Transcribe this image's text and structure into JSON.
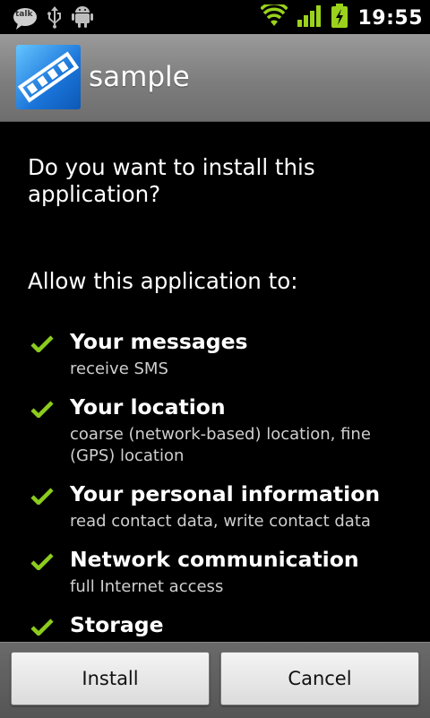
{
  "status_bar": {
    "talk_label": "talk",
    "time": "19:55",
    "icons": [
      "talk-icon",
      "usb-icon",
      "android-debug-icon",
      "wifi-icon",
      "signal-icon",
      "battery-charging-icon"
    ]
  },
  "header": {
    "app_name": "sample",
    "icon": "app-film-icon"
  },
  "main": {
    "question": "Do you want to install this application?",
    "allow_heading": "Allow this application to:",
    "permissions": [
      {
        "title": "Your messages",
        "description": "receive SMS"
      },
      {
        "title": "Your location",
        "description": "coarse (network-based) location, fine (GPS) location"
      },
      {
        "title": "Your personal information",
        "description": "read contact data, write contact data"
      },
      {
        "title": "Network communication",
        "description": "full Internet access"
      },
      {
        "title": "Storage",
        "description": ""
      }
    ]
  },
  "buttons": {
    "install": "Install",
    "cancel": "Cancel"
  },
  "colors": {
    "check": "#8ccc1e",
    "status_icons": "#9bd21c",
    "title_bar": "#8a8a8a"
  }
}
